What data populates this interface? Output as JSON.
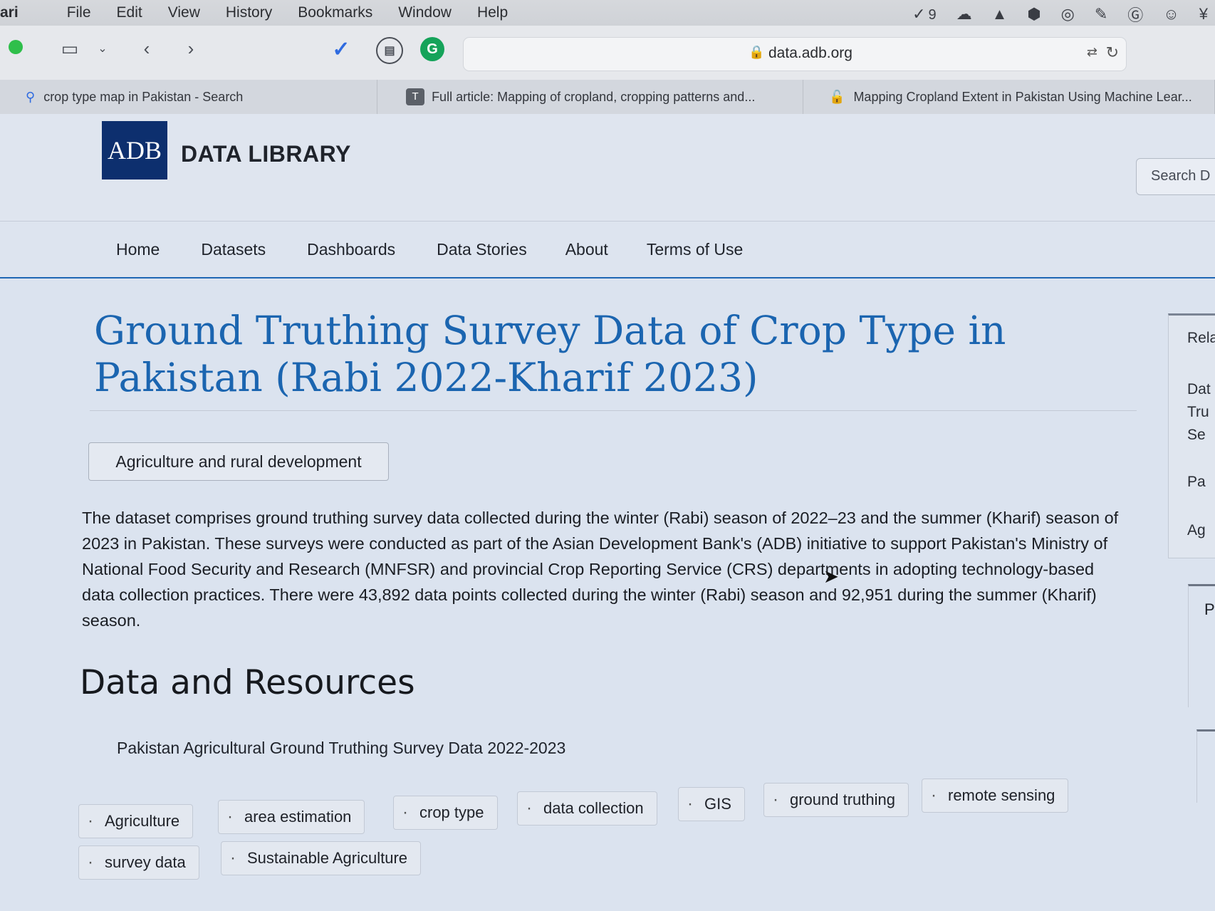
{
  "menubar": {
    "app": "ari",
    "items": [
      "File",
      "Edit",
      "View",
      "History",
      "Bookmarks",
      "Window",
      "Help"
    ],
    "badge_count": "9"
  },
  "toolbar": {
    "url": "data.adb.org"
  },
  "tabs": [
    {
      "label": "crop type map in Pakistan - Search",
      "icon": "search-icon"
    },
    {
      "label": "Full article: Mapping of cropland, cropping patterns and...",
      "icon": "T"
    },
    {
      "label": "Mapping Cropland Extent in Pakistan Using Machine Lear...",
      "icon": "unlock-icon"
    }
  ],
  "header": {
    "logo_mark": "ADB",
    "logo_text": "DATA LIBRARY",
    "search_placeholder": "Search D"
  },
  "nav": [
    "Home",
    "Datasets",
    "Dashboards",
    "Data Stories",
    "About",
    "Terms of Use"
  ],
  "main": {
    "title": "Ground Truthing Survey Data of Crop Type in Pakistan (Rabi 2022-Kharif 2023)",
    "category": "Agriculture and rural development",
    "description": "The dataset comprises ground truthing survey data collected during the winter (Rabi) season of 2022–23 and the summer (Kharif) season of 2023 in Pakistan. These surveys were conducted as part of the Asian Development Bank's (ADB) initiative to support Pakistan's Ministry of National Food Security and Research (MNFSR) and provincial Crop Reporting Service (CRS) departments in adopting technology-based data collection practices. There were 43,892 data points collected during the winter (Rabi) season and 92,951 during the summer (Kharif) season.",
    "section_title": "Data and Resources",
    "resource": "Pakistan Agricultural Ground Truthing Survey Data 2022-2023",
    "tags": [
      "Agriculture",
      "area estimation",
      "crop type",
      "data collection",
      "GIS",
      "ground truthing",
      "remote sensing",
      "survey data",
      "Sustainable Agriculture"
    ]
  },
  "sidebar": {
    "heading": "Rela",
    "line1": "Dat",
    "line2": "Tru",
    "line3": "Se",
    "line4": "Pa",
    "line5": "Ag",
    "box2": "P"
  }
}
